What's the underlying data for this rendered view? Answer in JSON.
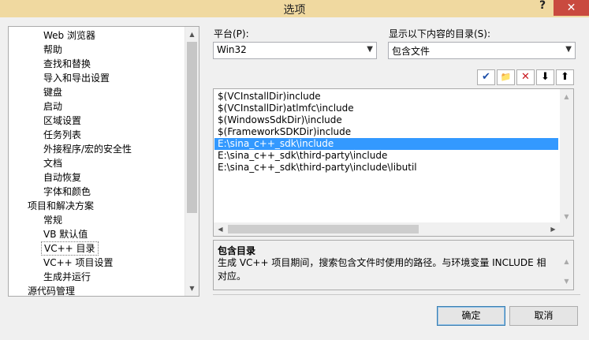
{
  "window": {
    "title": "选项",
    "help_glyph": "?",
    "close_glyph": "✕"
  },
  "tree": {
    "items": [
      {
        "label": "Web 浏览器"
      },
      {
        "label": "帮助"
      },
      {
        "label": "查找和替换"
      },
      {
        "label": "导入和导出设置"
      },
      {
        "label": "键盘"
      },
      {
        "label": "启动"
      },
      {
        "label": "区域设置"
      },
      {
        "label": "任务列表"
      },
      {
        "label": "外接程序/宏的安全性"
      },
      {
        "label": "文档"
      },
      {
        "label": "自动恢复"
      },
      {
        "label": "字体和颜色"
      },
      {
        "label": "项目和解决方案"
      },
      {
        "label": "常规"
      },
      {
        "label": "VB 默认值"
      },
      {
        "label": "VC++ 目录"
      },
      {
        "label": "VC++ 项目设置"
      },
      {
        "label": "生成并运行"
      },
      {
        "label": "源代码管理"
      }
    ]
  },
  "platform": {
    "label": "平台(P):",
    "value": "Win32"
  },
  "show_dirs": {
    "label": "显示以下内容的目录(S):",
    "value": "包含文件"
  },
  "toolbar": {
    "check_icon": "✔",
    "new_folder_icon": "📁",
    "delete_icon": "✕",
    "down_icon": "⬇",
    "up_icon": "⬆"
  },
  "directories": [
    "$(VCInstallDir)include",
    "$(VCInstallDir)atlmfc\\include",
    "$(WindowsSdkDir)\\include",
    "$(FrameworkSDKDir)include",
    "E:\\sina_c++_sdk\\include",
    "E:\\sina_c++_sdk\\third-party\\include",
    "E:\\sina_c++_sdk\\third-party\\include\\libutil"
  ],
  "selected_directory": "E:\\sina_c++_sdk\\include",
  "description": {
    "title": "包含目录",
    "text": "生成 VC++ 项目期间，搜索包含文件时使用的路径。与环境变量 INCLUDE 相对应。"
  },
  "buttons": {
    "ok": "确定",
    "cancel": "取消"
  },
  "colors": {
    "titlebar": "#f0d9a0",
    "close": "#c94a3f",
    "selection": "#3399ff"
  }
}
